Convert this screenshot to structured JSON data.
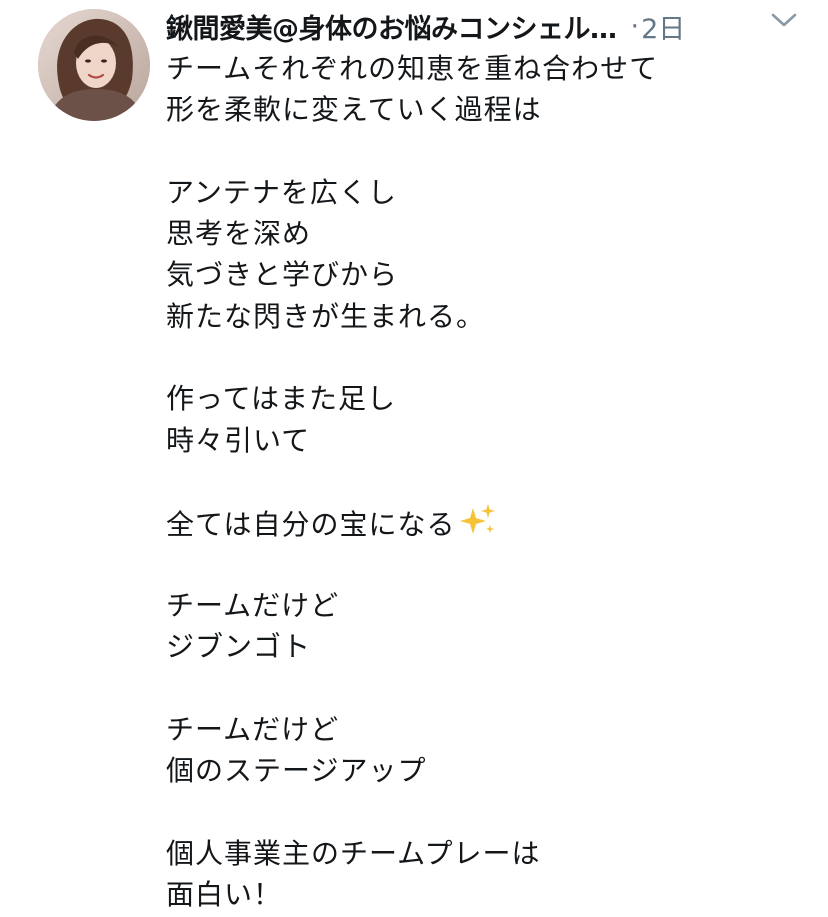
{
  "tweet": {
    "display_name": "鍬間愛美@身体のお悩みコンシェル…",
    "separator": "·",
    "time": "2日",
    "avatar_icon": "user-avatar-photo",
    "menu_icon": "chevron-down-icon",
    "lines": [
      "チームそれぞれの知恵を重ね合わせて",
      "形を柔軟に変えていく過程は",
      "",
      "アンテナを広くし",
      "思考を深め",
      "気づきと学びから",
      "新たな閃きが生まれる。",
      "",
      "作ってはまた足し",
      "時々引いて",
      "",
      "全ては自分の宝になる",
      "",
      "チームだけど",
      "ジブンゴト",
      "",
      "チームだけど",
      "個のステージアップ",
      "",
      "個人事業主のチームプレーは",
      "面白い！"
    ],
    "emoji_line_index": 11,
    "emoji_name": "sparkles-icon",
    "colors": {
      "text": "#14171a",
      "secondary": "#657786",
      "sparkle": "#f5c23a"
    }
  }
}
